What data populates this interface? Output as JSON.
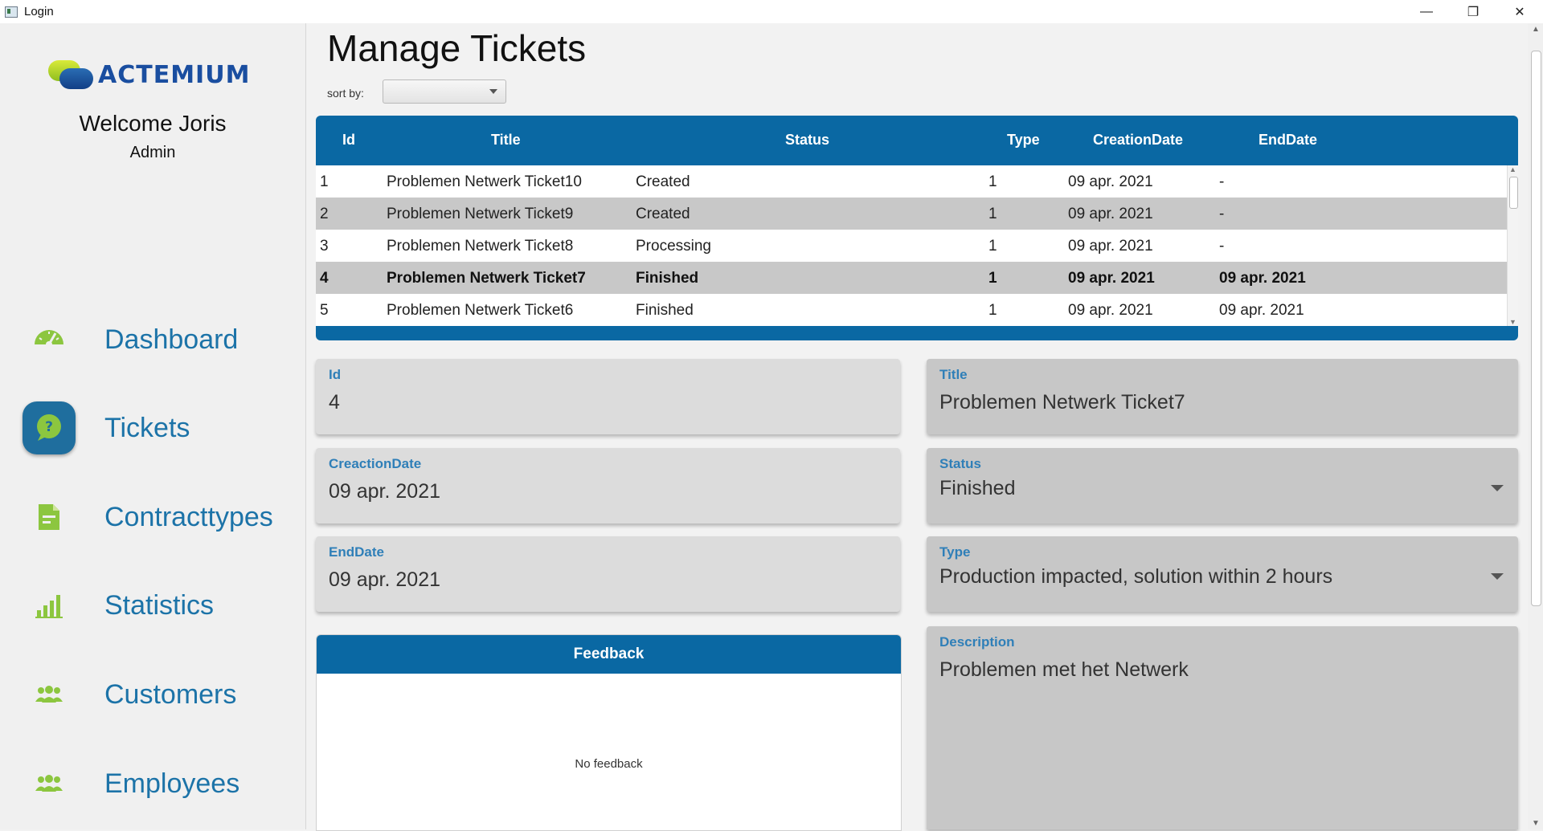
{
  "window": {
    "title": "Login",
    "minimize": "—",
    "restore": "❐",
    "close": "✕"
  },
  "sidebar": {
    "logo_text": "ACTEMIUM",
    "welcome": "Welcome Joris",
    "role": "Admin",
    "items": [
      {
        "label": "Dashboard",
        "icon": "speedometer-icon"
      },
      {
        "label": "Tickets",
        "icon": "question-bubble-icon",
        "active": true
      },
      {
        "label": "Contracttypes",
        "icon": "document-icon"
      },
      {
        "label": "Statistics",
        "icon": "bar-chart-icon"
      },
      {
        "label": "Customers",
        "icon": "users-icon"
      },
      {
        "label": "Employees",
        "icon": "users-icon"
      }
    ]
  },
  "main": {
    "title": "Manage Tickets",
    "sort_label": "sort by:",
    "sort_value": "",
    "table": {
      "columns": [
        "Id",
        "Title",
        "Status",
        "Type",
        "CreationDate",
        "EndDate"
      ],
      "rows": [
        {
          "id": "1",
          "title": "Problemen Netwerk Ticket10",
          "status": "Created",
          "type": "1",
          "creation": "09 apr. 2021",
          "end": "-"
        },
        {
          "id": "2",
          "title": "Problemen Netwerk Ticket9",
          "status": "Created",
          "type": "1",
          "creation": "09 apr. 2021",
          "end": "-"
        },
        {
          "id": "3",
          "title": "Problemen Netwerk Ticket8",
          "status": "Processing",
          "type": "1",
          "creation": "09 apr. 2021",
          "end": "-"
        },
        {
          "id": "4",
          "title": "Problemen Netwerk Ticket7",
          "status": "Finished",
          "type": "1",
          "creation": "09 apr. 2021",
          "end": "09 apr. 2021"
        },
        {
          "id": "5",
          "title": "Problemen Netwerk Ticket6",
          "status": "Finished",
          "type": "1",
          "creation": "09 apr. 2021",
          "end": "09 apr. 2021"
        }
      ]
    },
    "detail": {
      "id_label": "Id",
      "id_value": "4",
      "creation_label": "CreactionDate",
      "creation_value": "09 apr. 2021",
      "end_label": "EndDate",
      "end_value": "09 apr. 2021",
      "title_label": "Title",
      "title_value": "Problemen Netwerk Ticket7",
      "status_label": "Status",
      "status_value": "Finished",
      "type_label": "Type",
      "type_value": "Production impacted, solution within 2 hours",
      "description_label": "Description",
      "description_value": "Problemen met het Netwerk"
    },
    "feedback": {
      "header": "Feedback",
      "empty_text": "No feedback"
    }
  },
  "colors": {
    "accent": "#0a68a3",
    "nav_text": "#1c73a8",
    "icon_green": "#8cc63f",
    "field_label": "#2f7fb8"
  }
}
